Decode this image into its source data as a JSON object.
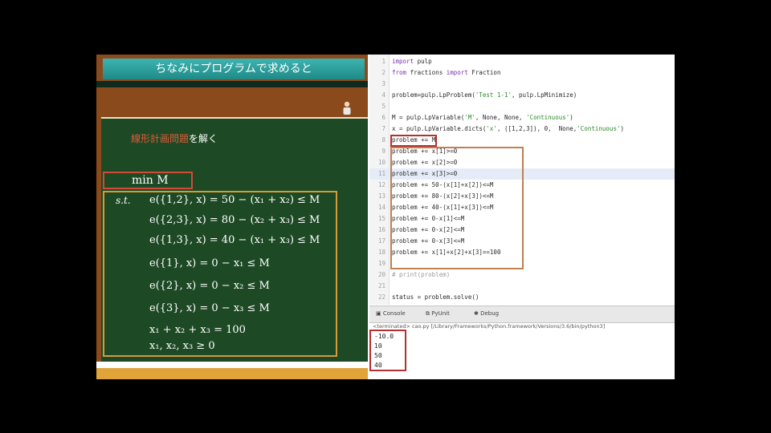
{
  "slide": {
    "title": "ちなみにプログラムで求めると",
    "subtitle_highlight": "線形計画問題",
    "subtitle_rest": "を解く",
    "objective": "min M",
    "st_label": "s.t.",
    "constraints": [
      "e({1,2}, x) = 50 − (x₁ + x₂) ≤ M",
      "e({2,3}, x) = 80 − (x₂ + x₃) ≤ M",
      "e({1,3}, x) = 40 − (x₁ + x₃) ≤ M",
      "e({1}, x) = 0 − x₁ ≤ M",
      "e({2}, x) = 0 − x₂ ≤ M",
      "e({3}, x) = 0 − x₃ ≤ M",
      "x₁ + x₂ + x₃ = 100",
      "x₁, x₂, x₃ ≥ 0"
    ]
  },
  "editor": {
    "lines": [
      {
        "n": "1",
        "code": "import pulp"
      },
      {
        "n": "2",
        "code": "from fractions import Fraction"
      },
      {
        "n": "3",
        "code": ""
      },
      {
        "n": "4",
        "code": "problem=pulp.LpProblem('Test 1-1', pulp.LpMinimize)"
      },
      {
        "n": "5",
        "code": ""
      },
      {
        "n": "6",
        "code": "M = pulp.LpVariable('M', None, None, 'Continuous')"
      },
      {
        "n": "7",
        "code": "x = pulp.LpVariable.dicts('x', ([1,2,3]), 0,  None,'Continuous')"
      },
      {
        "n": "8",
        "code": "problem += M"
      },
      {
        "n": "9",
        "code": "problem += x[1]>=0"
      },
      {
        "n": "10",
        "code": "problem += x[2]>=0"
      },
      {
        "n": "11",
        "code": "problem += x[3]>=0"
      },
      {
        "n": "12",
        "code": "problem += 50-(x[1]+x[2])<=M"
      },
      {
        "n": "13",
        "code": "problem += 80-(x[2]+x[3])<=M"
      },
      {
        "n": "14",
        "code": "problem += 40-(x[1]+x[3])<=M"
      },
      {
        "n": "15",
        "code": "problem += 0-x[1]<=M"
      },
      {
        "n": "16",
        "code": "problem += 0-x[2]<=M"
      },
      {
        "n": "17",
        "code": "problem += 0-x[3]<=M"
      },
      {
        "n": "18",
        "code": "problem += x[1]+x[2]+x[3]==100"
      },
      {
        "n": "19",
        "code": ""
      },
      {
        "n": "20",
        "code": "# print(problem)"
      },
      {
        "n": "21",
        "code": ""
      },
      {
        "n": "22",
        "code": "status = problem.solve()"
      }
    ]
  },
  "console": {
    "tabs": [
      "Console",
      "PyUnit",
      "Debug"
    ],
    "path": "<terminated> cao.py [/Library/Frameworks/Python.framework/Versions/3.6/bin/python3]",
    "output": [
      "-10.0",
      "10",
      "50",
      "40"
    ]
  },
  "colors": {
    "board_green": "#1d4a25",
    "highlight_red": "#e05a3a",
    "title_teal": "#2ea3a1",
    "box_orange": "#d59a3a",
    "box_red": "#d24a3a"
  }
}
